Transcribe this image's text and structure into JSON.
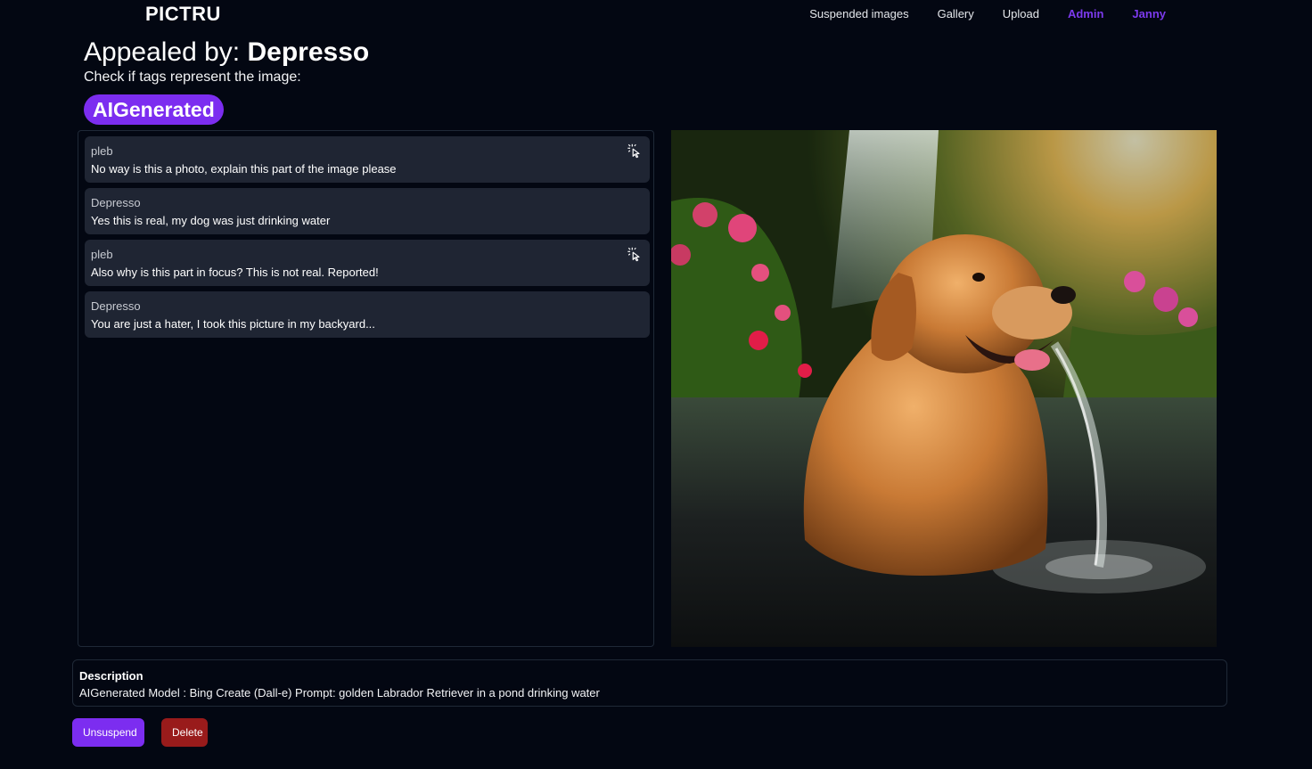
{
  "header": {
    "logo": "PICTRU",
    "nav": [
      {
        "label": "Suspended images"
      },
      {
        "label": "Gallery"
      },
      {
        "label": "Upload"
      },
      {
        "label": "Admin"
      },
      {
        "label": "Janny"
      }
    ]
  },
  "page": {
    "title_prefix": "Appealed by: ",
    "title_name": "Depresso",
    "subtitle": "Check if tags represent the image:",
    "tag": "AIGenerated"
  },
  "comments": [
    {
      "author": "pleb",
      "text": "No way is this a photo, explain this part of the image please",
      "icon": "cursor-click-icon"
    },
    {
      "author": "Depresso",
      "text": "Yes this is real, my dog was just drinking water"
    },
    {
      "author": "pleb",
      "text": "Also why is this part in focus? This is not real. Reported!",
      "icon": "cursor-click-icon"
    },
    {
      "author": "Depresso",
      "text": "You are just a hater, I took this picture in my backyard..."
    }
  ],
  "description": {
    "label": "Description",
    "text": "AIGenerated Model : Bing Create (Dall-e) Prompt: golden Labrador Retriever in a pond drinking water"
  },
  "actions": {
    "unsuspend": "Unsuspend",
    "delete": "Delete"
  },
  "colors": {
    "background": "#030712",
    "accent": "#7c2df0",
    "nav_accent": "#7c3aed",
    "comment_bg": "#1f2533",
    "danger": "#991b1b"
  }
}
